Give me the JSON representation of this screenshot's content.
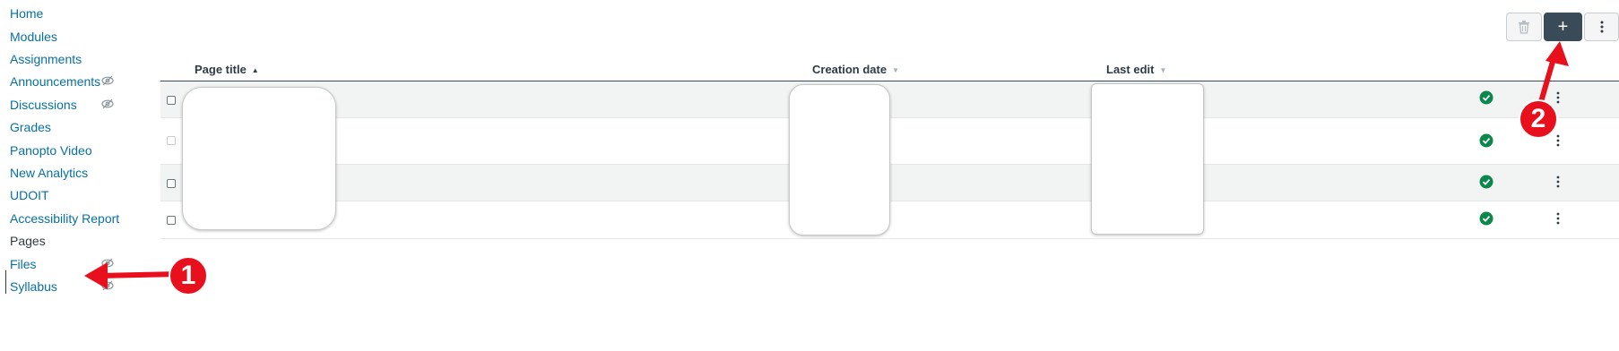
{
  "sidebar": {
    "items": [
      {
        "label": "Home",
        "hidden": false,
        "active": false
      },
      {
        "label": "Modules",
        "hidden": false,
        "active": false
      },
      {
        "label": "Assignments",
        "hidden": false,
        "active": false
      },
      {
        "label": "Announcements",
        "hidden": true,
        "active": false
      },
      {
        "label": "Discussions",
        "hidden": true,
        "active": false
      },
      {
        "label": "Grades",
        "hidden": false,
        "active": false
      },
      {
        "label": "Panopto Video",
        "hidden": false,
        "active": false
      },
      {
        "label": "New Analytics",
        "hidden": false,
        "active": false
      },
      {
        "label": "UDOIT",
        "hidden": false,
        "active": false
      },
      {
        "label": "Accessibility Report",
        "hidden": false,
        "active": false
      },
      {
        "label": "Pages",
        "hidden": false,
        "active": true
      },
      {
        "label": "Files",
        "hidden": true,
        "active": false
      },
      {
        "label": "Syllabus",
        "hidden": true,
        "active": false
      }
    ],
    "hidden_icon": "eye-slash-icon"
  },
  "toolbar": {
    "delete_icon": "trash-icon",
    "add_label": "+",
    "more_icon": "kebab-icon"
  },
  "table": {
    "columns": [
      {
        "label": "Page title",
        "sort": "▲"
      },
      {
        "label": "Creation date",
        "sort": "▼"
      },
      {
        "label": "Last edit",
        "sort": "▼"
      }
    ],
    "rows": [
      {
        "checkbox_enabled": true,
        "published": true
      },
      {
        "checkbox_enabled": false,
        "published": true
      },
      {
        "checkbox_enabled": true,
        "published": true
      },
      {
        "checkbox_enabled": true,
        "published": true
      }
    ],
    "published_icon": "check-circle-icon",
    "row_menu_icon": "kebab-icon"
  },
  "annotations": [
    {
      "number": "1",
      "color": "#e8101c"
    },
    {
      "number": "2",
      "color": "#e8101c"
    }
  ],
  "colors": {
    "link": "#0770a3",
    "published": "#0b874b",
    "primary_button": "#394b58",
    "annotation": "#e8101c"
  }
}
